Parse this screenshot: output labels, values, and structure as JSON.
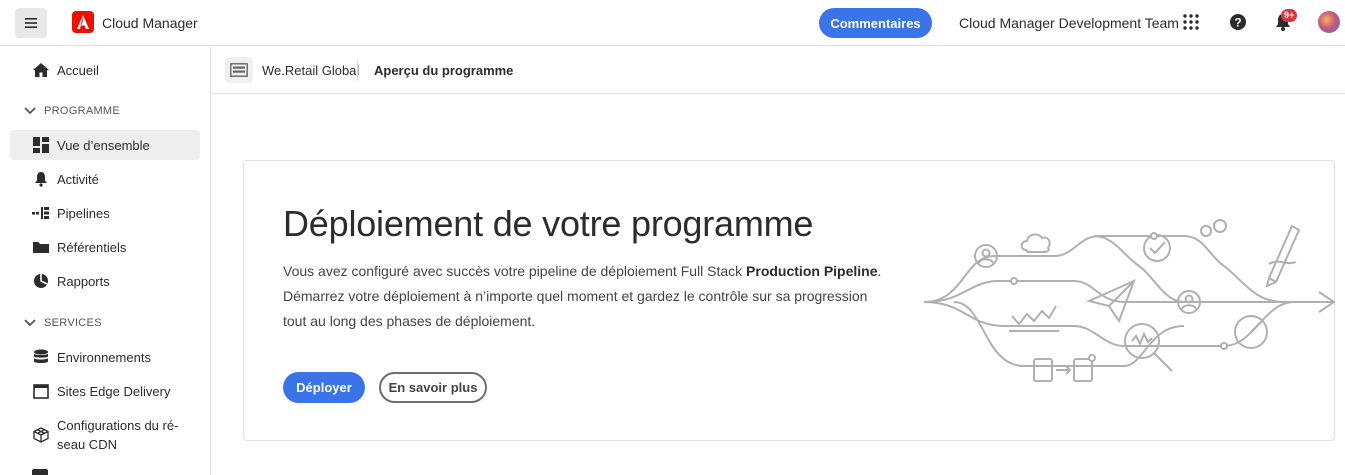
{
  "header": {
    "brand": "Cloud Manager",
    "feedback_label": "Commentaires",
    "team": "Cloud Manager Development Team",
    "notification_badge": "9+",
    "colors": {
      "accent": "#3b73e8",
      "adobe_red": "#eb1000",
      "badge": "#d7373f"
    }
  },
  "sidebar": {
    "home": "Accueil",
    "program_section": "PROGRAMME",
    "program_items": [
      {
        "label": "Vue d’ensemble",
        "icon": "overview-icon",
        "active": true
      },
      {
        "label": "Activité",
        "icon": "bell-icon"
      },
      {
        "label": "Pipelines",
        "icon": "pipeline-icon"
      },
      {
        "label": "Référentiels",
        "icon": "folder-icon"
      },
      {
        "label": "Rapports",
        "icon": "pie-chart-icon"
      }
    ],
    "services_section": "SERVICES",
    "service_items": [
      {
        "label": "Environnements",
        "icon": "database-icon"
      },
      {
        "label": "Sites Edge Delivery",
        "icon": "window-icon"
      },
      {
        "label": "Configurations du ré-",
        "label2": "seau CDN",
        "icon": "cube-icon"
      }
    ]
  },
  "breadcrumb": {
    "program": "We.Retail Global",
    "page": "Aperçu du programme"
  },
  "card": {
    "title": "Déploiement de votre programme",
    "body_pre": "Vous avez configuré avec succès votre pipeline de déploiement Full Stack ",
    "body_bold": "Production Pipeline",
    "body_post": ".",
    "body_line2": "Démarrez votre déploiement à n’importe quel moment et gardez le contrôle sur sa progression",
    "body_line3": "tout au long des phases de déploiement.",
    "deploy_label": "Déployer",
    "learn_more_label": "En savoir plus"
  }
}
